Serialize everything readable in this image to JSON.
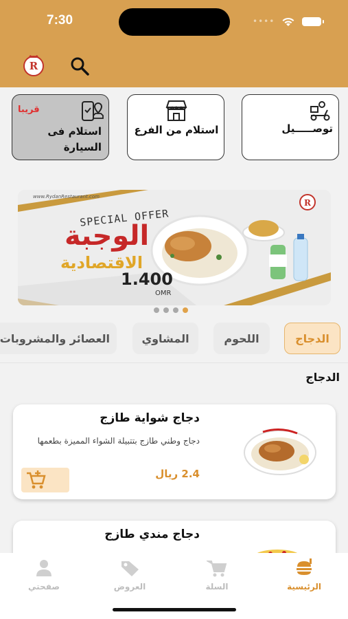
{
  "status_bar": {
    "time": "7:30"
  },
  "services": [
    {
      "label": "توصـــــيل",
      "icon": "delivery-scooter-icon"
    },
    {
      "label": "استلام من الفرع",
      "icon": "store-icon"
    },
    {
      "label_line1": "استلام فى",
      "label_line2": "السيارة",
      "badge": "قريبا",
      "icon": "car-pickup-phone-icon"
    }
  ],
  "banner": {
    "site": "www.RydanRestaurant.com",
    "tag": "SPECIAL OFFER",
    "title": "الوجبة",
    "subtitle": "الاقتصادية",
    "price": "1.400",
    "currency": "OMR",
    "pages": 4,
    "active_page": 4
  },
  "categories": [
    "الدجاج",
    "اللحوم",
    "المشاوي",
    "العصائر والمشروبات"
  ],
  "active_category": "الدجاج",
  "section_title": "الدجاج",
  "products": [
    {
      "name": "دجاج شواية طازج",
      "description": "دجاج وطني طازج بتتبيلة الشواء المميزة بطعمها",
      "price": "2.4 ريال"
    },
    {
      "name": "دجاج مندي طازج"
    }
  ],
  "bottom_nav": [
    {
      "label": "الرئيسية",
      "icon": "home-burger-icon",
      "active": true
    },
    {
      "label": "السلة",
      "icon": "cart-icon",
      "active": false
    },
    {
      "label": "العروض",
      "icon": "tag-icon",
      "active": false
    },
    {
      "label": "صفحتي",
      "icon": "person-icon",
      "active": false
    }
  ],
  "colors": {
    "brand": "#d8a051",
    "accent": "#d98f2d",
    "soon": "#e03030"
  }
}
